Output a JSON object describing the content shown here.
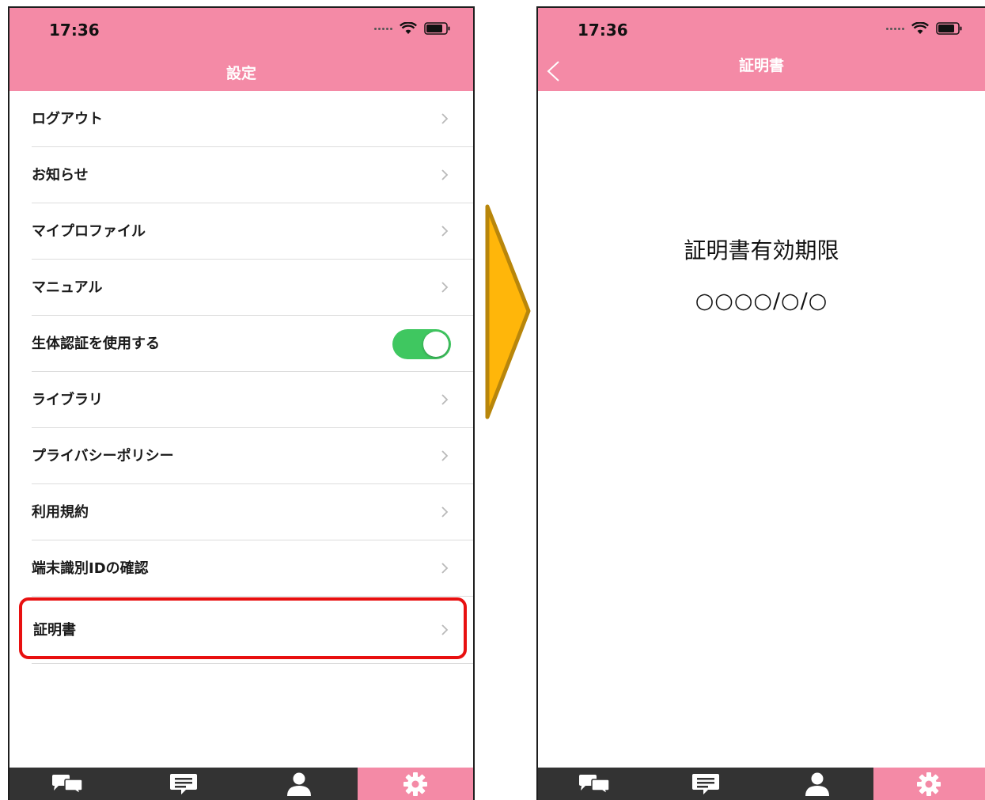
{
  "left_screen": {
    "status_time": "17:36",
    "title": "設定",
    "items": [
      {
        "label": "ログアウト"
      },
      {
        "label": "お知らせ"
      },
      {
        "label": "マイプロファイル"
      },
      {
        "label": "マニュアル"
      },
      {
        "label": "生体認証を使用する",
        "toggle_on": true
      },
      {
        "label": "ライブラリ"
      },
      {
        "label": "プライバシーポリシー"
      },
      {
        "label": "利用規約"
      },
      {
        "label": "端末識別IDの確認"
      },
      {
        "label": "証明書",
        "highlighted": true
      }
    ]
  },
  "right_screen": {
    "status_time": "17:36",
    "title": "証明書",
    "cert_label": "証明書有効期限",
    "cert_date": "○○○○/○/○"
  },
  "tabbar": {
    "tabs": [
      {
        "icon": "chat-bubbles-icon"
      },
      {
        "icon": "message-icon"
      },
      {
        "icon": "person-icon"
      },
      {
        "icon": "gear-icon",
        "active": true
      }
    ]
  },
  "colors": {
    "header_pink": "#f48aa6",
    "toggle_green": "#3fc760",
    "highlight_red": "#e81010",
    "arrow_fill": "#ffb60a",
    "arrow_stroke": "#b8860b",
    "tabbar_bg": "#333333"
  }
}
